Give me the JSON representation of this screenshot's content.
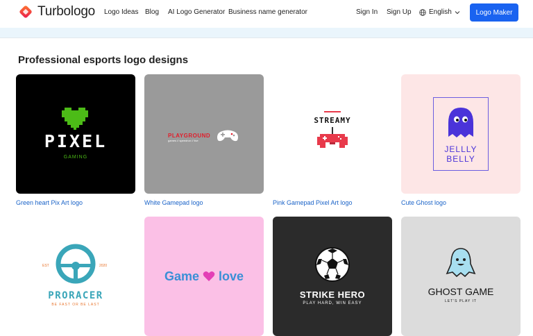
{
  "header": {
    "brand": "Turbologo",
    "nav": [
      "Logo Ideas",
      "Blog",
      "AI Logo Generator",
      "Business name generator"
    ],
    "sign_in": "Sign In",
    "sign_up": "Sign Up",
    "language": "English",
    "cta": "Logo Maker"
  },
  "section": {
    "title": "Professional esports logo designs"
  },
  "cards": [
    {
      "caption": "Green heart Pix Art logo",
      "title": "PIXEL",
      "subtitle": "GAMING"
    },
    {
      "caption": "White Gamepad logo",
      "title": "PLAYGROUND",
      "subtitle": "games // speedrun // live"
    },
    {
      "caption": "Pink Gamepad Pixel Art logo",
      "title": "STREAMY"
    },
    {
      "caption": "Cute Ghost logo",
      "title": "JELLLY",
      "title2": "BELLY"
    },
    {
      "title": "PRORACER",
      "subtitle": "BE FAST OR BE LAST",
      "est": "EST",
      "year": "2020"
    },
    {
      "title": "Game",
      "title2": "love"
    },
    {
      "title": "STRIKE HERO",
      "subtitle": "PLAY HARD, WIN EASY"
    },
    {
      "title": "GHOST GAME",
      "subtitle": "LET'S PLAY IT"
    }
  ],
  "colors": {
    "accent": "#1a63f0",
    "link": "#1a63c8"
  }
}
